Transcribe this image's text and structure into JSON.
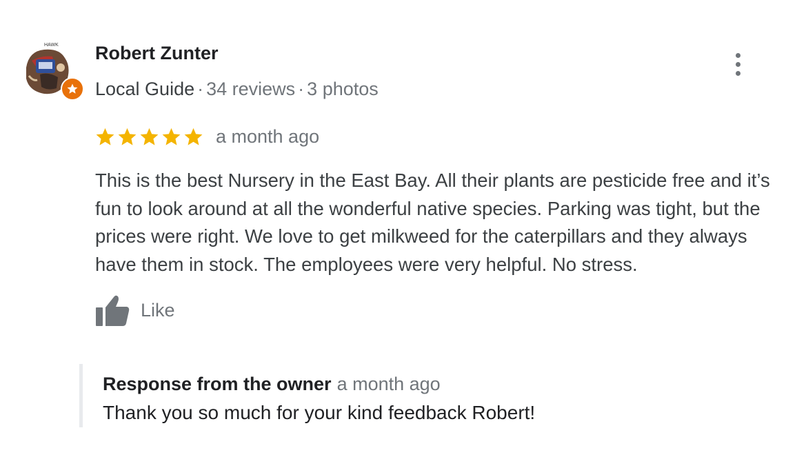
{
  "reviewer": {
    "name": "Robert Zunter",
    "badge": "Local Guide",
    "reviews_count": "34 reviews",
    "photos_count": "3 photos",
    "avatar_caption": "HAWK"
  },
  "review": {
    "rating": 5,
    "rating_max": 5,
    "date": "a month ago",
    "text": "This is the best Nursery in the East Bay. All their plants are pesticide free and it’s fun to look around at all the wonderful native species. Parking was tight, but the prices were right. We love to get milkweed for the caterpillars and they always have them in stock. The employees were very helpful. No stress."
  },
  "actions": {
    "like_label": "Like",
    "more_icon": "more-vert-icon",
    "like_icon": "thumbs-up-icon"
  },
  "owner_response": {
    "title": "Response from the owner",
    "date": "a month ago",
    "text": "Thank you so much for your kind feedback Robert!"
  },
  "colors": {
    "star": "#f4b400",
    "guide_badge": "#e8710a",
    "text_primary": "#202124",
    "text_secondary": "#70757a",
    "icon": "#70757a"
  }
}
